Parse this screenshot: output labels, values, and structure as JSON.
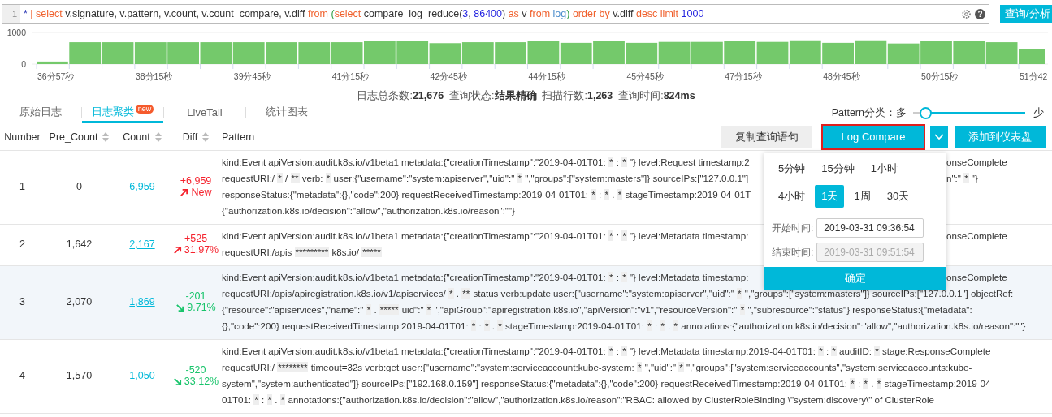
{
  "query": {
    "line_number": "1",
    "tokens": [
      {
        "kind": "op",
        "text": "*"
      },
      {
        "kind": "kw",
        "text": " | "
      },
      {
        "kind": "kw",
        "text": "select"
      },
      {
        "kind": "plain",
        "text": " v.signature, v.pattern, v.count, v.count_compare, v.diff "
      },
      {
        "kind": "kw",
        "text": "from "
      },
      {
        "kind": "paren",
        "text": "("
      },
      {
        "kind": "kw",
        "text": "select"
      },
      {
        "kind": "plain",
        "text": " compare_log_reduce("
      },
      {
        "kind": "num",
        "text": "3"
      },
      {
        "kind": "plain",
        "text": ", "
      },
      {
        "kind": "num",
        "text": "86400"
      },
      {
        "kind": "plain",
        "text": ") "
      },
      {
        "kind": "kw",
        "text": "as"
      },
      {
        "kind": "plain",
        "text": " v "
      },
      {
        "kind": "kw",
        "text": "from "
      },
      {
        "kind": "table",
        "text": "log"
      },
      {
        "kind": "paren",
        "text": ") "
      },
      {
        "kind": "kw",
        "text": "order by"
      },
      {
        "kind": "plain",
        "text": " v.diff "
      },
      {
        "kind": "kw",
        "text": "desc limit "
      },
      {
        "kind": "num",
        "text": "1000"
      }
    ],
    "help_icon": "?",
    "submit": "查询/分析"
  },
  "histogram": {
    "chart_data": {
      "type": "bar",
      "ylim": [
        0,
        1000
      ],
      "yticks": [
        0,
        1000
      ],
      "values": [
        80,
        690,
        690,
        690,
        690,
        690,
        690,
        690,
        690,
        690,
        720,
        720,
        660,
        690,
        690,
        720,
        670,
        740,
        670,
        700,
        700,
        720,
        700,
        750,
        670,
        750,
        650,
        720,
        720,
        690,
        470
      ],
      "categories": [
        "36分57秒",
        null,
        null,
        "38分15秒",
        null,
        null,
        "39分45秒",
        null,
        null,
        "41分15秒",
        null,
        null,
        "42分45秒",
        null,
        null,
        "44分15秒",
        null,
        null,
        "45分45秒",
        null,
        null,
        "47分15秒",
        null,
        null,
        "48分45秒",
        null,
        null,
        "50分15秒",
        null,
        null,
        "51分42"
      ]
    }
  },
  "summary": "日志总条数:**21,676**  查询状态:**结果精确**  扫描行数:**1,263**  查询时间:**824ms**",
  "tabs": [
    {
      "label": "原始日志",
      "selected": false
    },
    {
      "label": "日志聚类",
      "selected": true,
      "badge": "new"
    },
    {
      "label": "LiveTail",
      "selected": false
    },
    {
      "label": "统计图表",
      "selected": false
    }
  ],
  "pattern_slider": {
    "label": "Pattern分类：多",
    "end_label": "少",
    "level": 0.1
  },
  "toolbar": [
    {
      "label": "复制查询语句",
      "kind": "plain",
      "highlighted": false
    },
    {
      "label": "Log Compare",
      "kind": "primary",
      "highlighted": true
    },
    {
      "kind": "caret",
      "highlighted": false
    },
    {
      "label": "添加到仪表盘",
      "kind": "primary",
      "highlighted": false
    }
  ],
  "table": {
    "columns": [
      {
        "label": "Number",
        "sortable": false
      },
      {
        "label": "Pre_Count",
        "sortable": true
      },
      {
        "label": "Count",
        "sortable": true
      },
      {
        "label": "Diff",
        "sortable": true
      },
      {
        "label": "Pattern",
        "sortable": false
      }
    ],
    "rows": [
      {
        "number": "1",
        "pre_count": "0",
        "count": "6,959",
        "diff": "+6,959",
        "kind": "increase",
        "change": "New",
        "highlighted": false,
        "pattern": [
          {
            "left": "kind:Event apiVersion:audit.k8s.io/v1beta1 metadata:{\"creationTimestamp\":\"2019-04-01T01: * : * \"} level:Request timestamp:2",
            "right": "onseComplete"
          },
          {
            "left": "requestURI:/ * / ** verb: * user:{\"username\":\"system:apiserver\",\"uid\":\" * \",\"groups\":[\"system:masters\"]} sourceIPs:[\"127.0.0.1\"]",
            "right": "n\":\" * \"}"
          },
          {
            "left": "responseStatus:{\"metadata\":{},\"code\":200} requestReceivedTimestamp:2019-04-01T01: * : * . * stageTimestamp:2019-04-01T"
          },
          {
            "left": "{\"authorization.k8s.io/decision\":\"allow\",\"authorization.k8s.io/reason\":\"\"}"
          }
        ]
      },
      {
        "number": "2",
        "pre_count": "1,642",
        "count": "2,167",
        "diff": "+525",
        "kind": "increase",
        "change": "31.97%",
        "highlighted": false,
        "pattern": [
          {
            "left": "kind:Event apiVersion:audit.k8s.io/v1beta1 metadata:{\"creationTimestamp\":\"2019-04-01T01: * : * \"} level:Metadata timestamp:",
            "right": "onseComplete"
          },
          {
            "left": "requestURI:/apis ********* k8s.io/ *****"
          }
        ]
      },
      {
        "number": "3",
        "pre_count": "2,070",
        "count": "1,869",
        "diff": "-201",
        "kind": "decrease",
        "change": "9.71%",
        "highlighted": true,
        "pattern": [
          {
            "left": "kind:Event apiVersion:audit.k8s.io/v1beta1 metadata:{\"creationTimestamp\":\"2019-04-01T01: * : * \"} level:Metadata timestamp:",
            "right": "onseComplete"
          },
          {
            "left": "requestURI:/apis/apiregistration.k8s.io/v1/apiservices/ * . ** status verb:update user:{\"username\":\"system:apiserver\",\"uid\":\" * \",\"groups\":[\"system:masters\"]} sourceIPs:[\"127.0.0.1\"] objectRef:"
          },
          {
            "left": "{\"resource\":\"apiservices\",\"name\":\" * . ***** uid\":\" * \",\"apiGroup\":\"apiregistration.k8s.io\",\"apiVersion\":\"v1\",\"resourceVersion\":\" * \",\"subresource\":\"status\"} responseStatus:{\"metadata\":"
          },
          {
            "left": "{},\"code\":200} requestReceivedTimestamp:2019-04-01T01: * : * . * stageTimestamp:2019-04-01T01: * : * . * annotations:{\"authorization.k8s.io/decision\":\"allow\",\"authorization.k8s.io/reason\":\"\"}"
          }
        ]
      },
      {
        "number": "4",
        "pre_count": "1,570",
        "count": "1,050",
        "diff": "-520",
        "kind": "decrease",
        "change": "33.12%",
        "highlighted": false,
        "pattern": [
          {
            "left": "kind:Event apiVersion:audit.k8s.io/v1beta1 metadata:{\"creationTimestamp\":\"2019-04-01T01: * : * \"} level:Metadata timestamp:2019-04-01T01: * : * auditID: * stage:ResponseComplete"
          },
          {
            "left": "requestURI:/ ******** timeout=32s verb:get user:{\"username\":\"system:serviceaccount:kube-system: * \",\"uid\":\" * \",\"groups\":[\"system:serviceaccounts\",\"system:serviceaccounts:kube-"
          },
          {
            "left": "system\",\"system:authenticated\"]} sourceIPs:[\"192.168.0.159\"] responseStatus:{\"metadata\":{},\"code\":200} requestReceivedTimestamp:2019-04-01T01: * : * . * stageTimestamp:2019-04-"
          },
          {
            "left": "01T01: * : * . * annotations:{\"authorization.k8s.io/decision\":\"allow\",\"authorization.k8s.io/reason\":\"RBAC: allowed by ClusterRoleBinding \\\"system:discovery\\\" of ClusterRole"
          }
        ]
      }
    ]
  },
  "compare_popover": {
    "ranges": [
      [
        {
          "label": "5分钟",
          "selected": false
        },
        {
          "label": "15分钟",
          "selected": false
        },
        {
          "label": "1小时",
          "selected": false
        }
      ],
      [
        {
          "label": "4小时",
          "selected": false
        },
        {
          "label": "1天",
          "selected": true
        },
        {
          "label": "1周",
          "selected": false
        },
        {
          "label": "30天",
          "selected": false
        }
      ]
    ],
    "start": {
      "label": "开始时间:",
      "value": "2019-03-31 09:36:54",
      "disabled": false
    },
    "end": {
      "label": "结束时间:",
      "value": "2019-03-31 09:51:54",
      "disabled": true
    },
    "confirm": "确定"
  }
}
